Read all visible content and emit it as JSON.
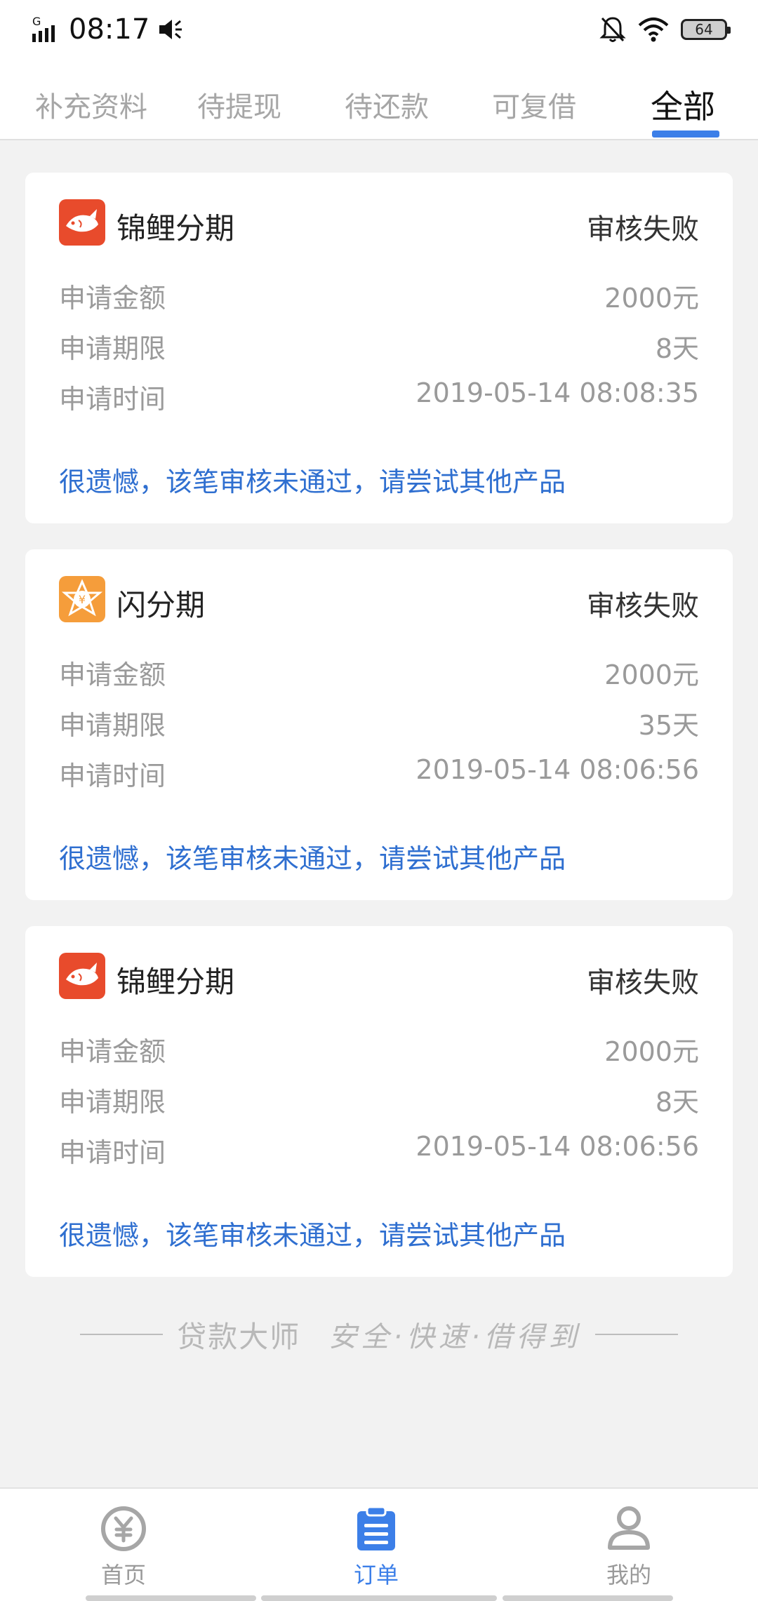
{
  "status_bar": {
    "time": "08:17",
    "network": "G",
    "battery": "64"
  },
  "tabs": [
    {
      "label": "补充资料"
    },
    {
      "label": "待提现"
    },
    {
      "label": "待还款"
    },
    {
      "label": "可复借"
    },
    {
      "label": "全部"
    }
  ],
  "active_tab": "全部",
  "labels": {
    "amount": "申请金额",
    "term": "申请期限",
    "time": "申请时间"
  },
  "orders": [
    {
      "product": "锦鲤分期",
      "logo_icon": "koi-fish-icon",
      "status": "审核失败",
      "amount": "2000元",
      "term": "8天",
      "time": "2019-05-14 08:08:35",
      "note": "很遗憾，该笔审核未通过，请尝试其他产品"
    },
    {
      "product": "闪分期",
      "logo_icon": "yuan-star-icon",
      "status": "审核失败",
      "amount": "2000元",
      "term": "35天",
      "time": "2019-05-14 08:06:56",
      "note": "很遗憾，该笔审核未通过，请尝试其他产品"
    },
    {
      "product": "锦鲤分期",
      "logo_icon": "koi-fish-icon",
      "status": "审核失败",
      "amount": "2000元",
      "term": "8天",
      "time": "2019-05-14 08:06:56",
      "note": "很遗憾，该笔审核未通过，请尝试其他产品"
    }
  ],
  "slogan": {
    "brand": "贷款大师",
    "motto": "安全·快速·借得到"
  },
  "bottom_nav": [
    {
      "label": "首页",
      "icon": "yuan-coin-icon"
    },
    {
      "label": "订单",
      "icon": "clipboard-icon"
    },
    {
      "label": "我的",
      "icon": "user-icon"
    }
  ],
  "colors": {
    "accent": "#3c7fe8",
    "note_blue": "#2f6fd0",
    "koi_logo": "#e84b2c",
    "shan_logo": "#f59d3b",
    "background": "#f2f2f2"
  }
}
